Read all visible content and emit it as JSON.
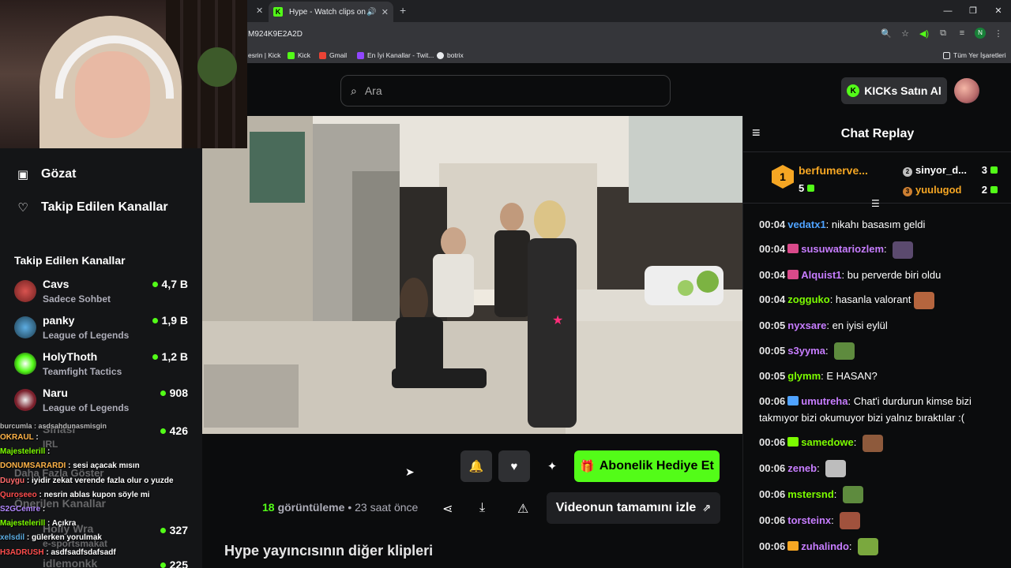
{
  "browser": {
    "tab_title": "Hype - Watch clips on Kick",
    "url": "M924K9E2A2D",
    "bookmarks": [
      "esrin | Kick",
      "Kick",
      "Gmail",
      "En İyi Kanallar - Twit...",
      "botrix"
    ],
    "bookmarks_right": "Tüm Yer İşaretleri",
    "profile_initial": "N"
  },
  "header": {
    "search_placeholder": "Ara",
    "kicks_label": "KICKs Satın Al"
  },
  "sidebar": {
    "nav": [
      {
        "label": "Gözat",
        "icon": "browse-icon"
      },
      {
        "label": "Takip Edilen Kanallar",
        "icon": "heart-icon"
      }
    ],
    "followed_title": "Takip Edilen Kanallar",
    "channels": [
      {
        "name": "Cavs",
        "category": "Sadece Sohbet",
        "viewers": "4,7 B"
      },
      {
        "name": "panky",
        "category": "League of Legends",
        "viewers": "1,9 B"
      },
      {
        "name": "HolyThoth",
        "category": "Teamfight Tactics",
        "viewers": "1,2 B"
      },
      {
        "name": "Naru",
        "category": "League of Legends",
        "viewers": "908"
      }
    ],
    "hidden_viewers": [
      "426",
      "327",
      "225"
    ],
    "ghost_texts": [
      "Sinasi",
      "IRL",
      "Daha Fazla Göster",
      "Önerilen Kanallar",
      "Holly Wra",
      "e-sportsmakat",
      "idlemonkk"
    ]
  },
  "overlay_chat": [
    {
      "user": "OKRAUL",
      "color": "#ffb347",
      "text": ":"
    },
    {
      "user": "Majestelerill",
      "color": "#7cfc00",
      "text": ":"
    },
    {
      "user": "DONUMSARARDI",
      "color": "#ffb347",
      "text": ": sesi açacak mısın"
    },
    {
      "user": "Duygu",
      "color": "#ff6b6b",
      "text": ": iyidir zekat verende fazla olur o yuzde"
    },
    {
      "user": "Quroseeo",
      "color": "#ff4d4d",
      "text": ": nesrin ablas kupon söyle mi"
    },
    {
      "user": "S2GCemre",
      "color": "#b388ff",
      "text": ":"
    },
    {
      "user": "Majestelerill",
      "color": "#7cfc00",
      "text": ": Açıkra"
    },
    {
      "user": "xelsdil",
      "color": "#5dade2",
      "text": ": gülerken yorulmak"
    },
    {
      "user": "H3ADRUSH",
      "color": "#ff4d4d",
      "text": ": asdfsadfsdafsadf"
    }
  ],
  "overlay_chat_top": "burcumla : asdsahdunasmisgin",
  "video": {
    "actions": {
      "subscribe_gift_label": "Abonelik Hediye Et"
    },
    "views_count": "18",
    "views_label": "görüntüleme",
    "age": "• 23 saat önce",
    "full_video_label": "Videonun tamamını izle",
    "more_clips_title": "Hype yayıncısının diğer klipleri"
  },
  "chat": {
    "title": "Chat Replay",
    "leaderboard": {
      "first": {
        "name": "berfumerve...",
        "count": "5",
        "rank": "1"
      },
      "second": {
        "name": "sinyor_d...",
        "count": "3",
        "rank": "2"
      },
      "third": {
        "name": "yuulugod",
        "count": "2",
        "rank": "3"
      }
    },
    "messages": [
      {
        "time": "00:04",
        "user": "vedatx1",
        "color": "#4fa3ff",
        "text": "nikahı basasım geldi",
        "emote": ""
      },
      {
        "time": "00:04",
        "user": "susuwatariozlem",
        "color": "#c77dff",
        "text": "",
        "emote": "#5b4a6e",
        "badge": "#d94a8a"
      },
      {
        "time": "00:04",
        "user": "Alquist1",
        "color": "#c77dff",
        "text": "bu perverde biri oldu",
        "emote": "",
        "badge": "#d94a8a"
      },
      {
        "time": "00:04",
        "user": "zogguko",
        "color": "#7cfc00",
        "text": "hasanla valorant",
        "emote": "#b5653e"
      },
      {
        "time": "00:05",
        "user": "nyxsare",
        "color": "#c77dff",
        "text": "en iyisi eylül",
        "emote": ""
      },
      {
        "time": "00:05",
        "user": "s3yyma",
        "color": "#c77dff",
        "text": "",
        "emote": "#5e8b3e"
      },
      {
        "time": "00:05",
        "user": "glymm",
        "color": "#7cfc00",
        "text": "E HASAN?",
        "emote": ""
      },
      {
        "time": "00:06",
        "user": "umutreha",
        "color": "#c77dff",
        "text": "Chat'i durdurun kimse bizi takmıyor bizi okumuyor bizi yalnız bıraktılar :(",
        "emote": "",
        "badge": "#4fa3ff"
      },
      {
        "time": "00:06",
        "user": "samedowe",
        "color": "#7cfc00",
        "text": "",
        "emote": "#8e5a3c",
        "badge": "#7cfc00"
      },
      {
        "time": "00:06",
        "user": "zeneb",
        "color": "#c77dff",
        "text": "",
        "emote": "#bdbdbd"
      },
      {
        "time": "00:06",
        "user": "mstersnd",
        "color": "#7cfc00",
        "text": "",
        "emote": "#5e8b3e"
      },
      {
        "time": "00:06",
        "user": "torsteinx",
        "color": "#c77dff",
        "text": "",
        "emote": "#a0523d"
      },
      {
        "time": "00:06",
        "user": "zuhalindo",
        "color": "#c77dff",
        "text": "",
        "emote": "#7aa83e",
        "badge": "#f5a623"
      }
    ]
  },
  "colors": {
    "accent": "#53fc18",
    "background": "#0b0c0d",
    "panel": "#141517"
  }
}
